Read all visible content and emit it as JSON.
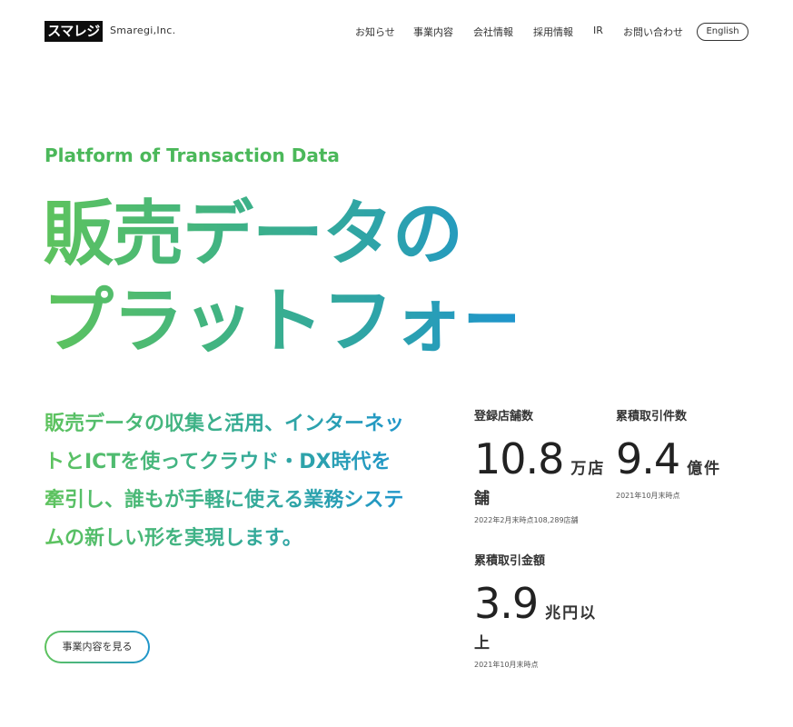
{
  "header": {
    "logo_text": "スマレジ",
    "company_name": "Smaregi,Inc.",
    "nav": [
      "お知らせ",
      "事業内容",
      "会社情報",
      "採用情報",
      "IR",
      "お問い合わせ"
    ],
    "lang_button": "English"
  },
  "hero": {
    "tagline": "Platform of Transaction Data",
    "title_line1": "販売データの",
    "title_line2": "プラットフォーム",
    "description": "販売データの収集と活用、インターネットとICTを使ってクラウド・DX時代を牽引し、誰もが手軽に使える業務システムの新しい形を実現します。",
    "cta_label": "事業内容を見る"
  },
  "stats": [
    {
      "label": "登録店舗数",
      "value": "10.8",
      "unit": "万店",
      "unit_tail": "舗",
      "note": "2022年2月末時点108,289店舗"
    },
    {
      "label": "累積取引件数",
      "value": "9.4",
      "unit": "億件",
      "unit_tail": "",
      "note": "2021年10月末時点"
    },
    {
      "label": "累積取引金額",
      "value": "3.9",
      "unit": "兆円以",
      "unit_tail": "上",
      "note": "2021年10月末時点"
    }
  ],
  "colors": {
    "gradient_start": "#5ec35d",
    "gradient_end": "#1f95cc",
    "text": "#333333"
  }
}
